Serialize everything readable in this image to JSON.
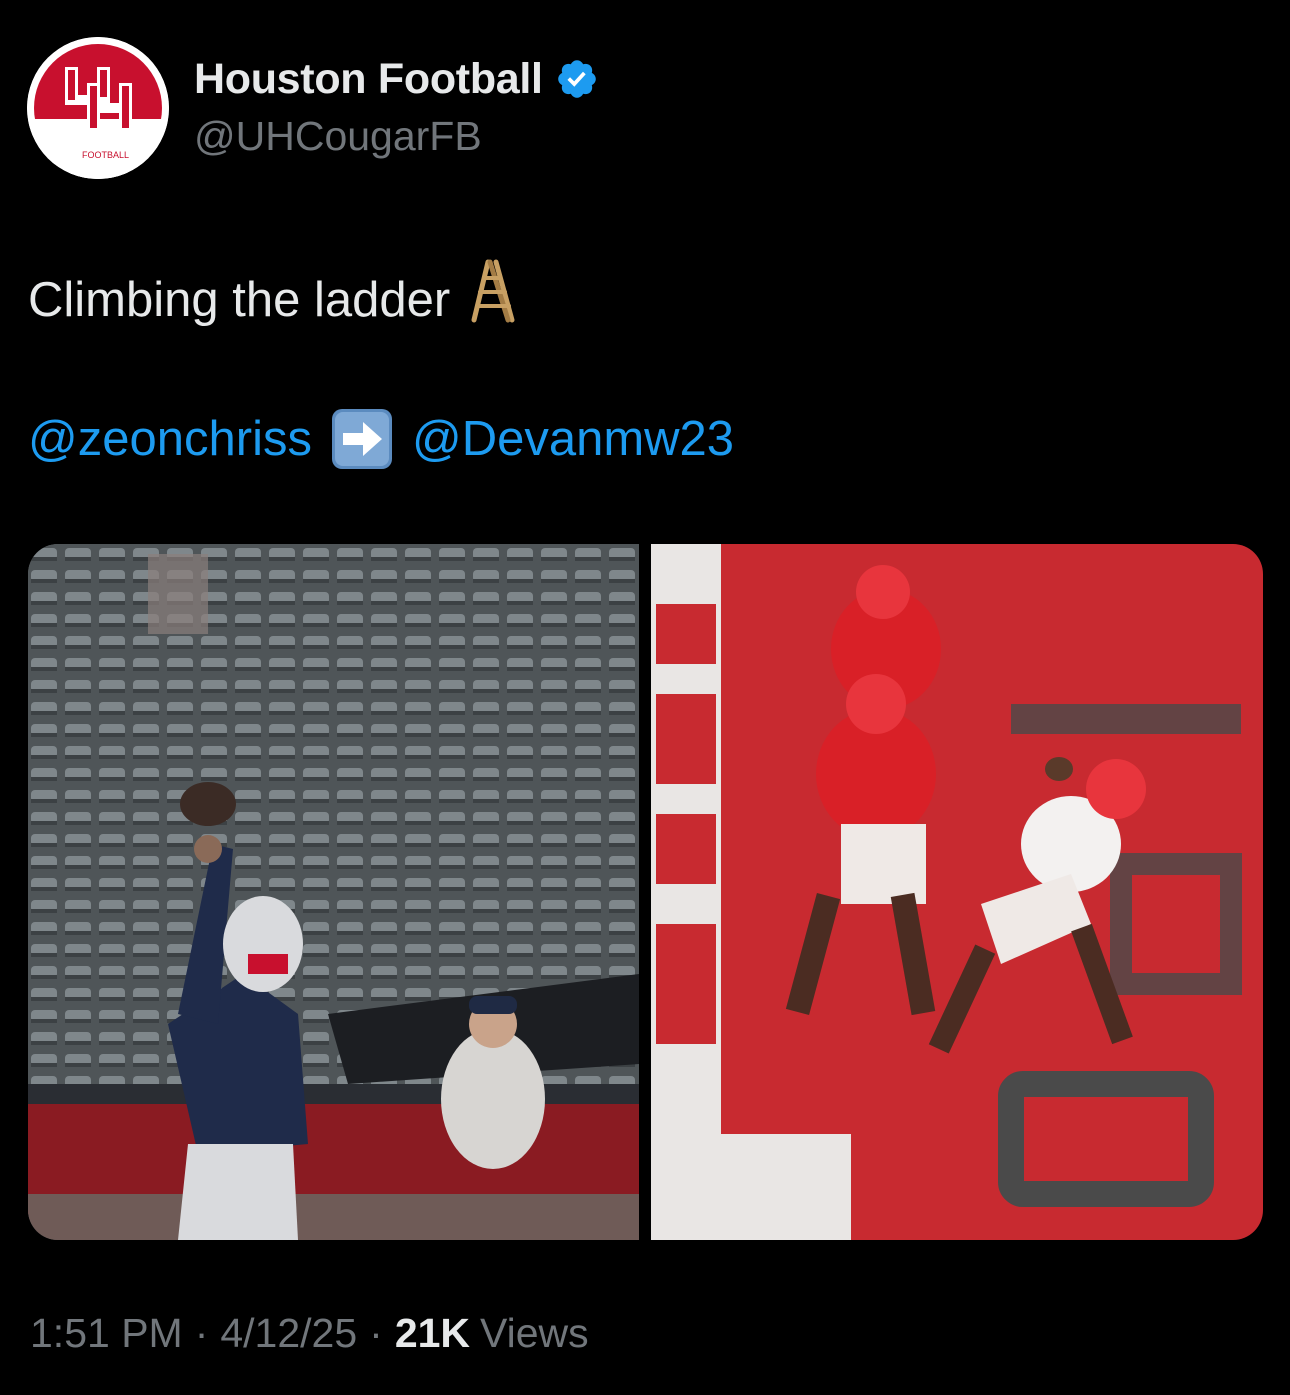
{
  "author": {
    "display_name": "Houston Football",
    "handle": "@UHCougarFB",
    "verified": true,
    "avatar_icon": "uh-football-logo",
    "avatar_logo_text": "FOOTBALL"
  },
  "tweet": {
    "text": "Climbing the ladder",
    "text_emoji": "ladder-emoji",
    "mention_1": "@zeonchriss",
    "arrow_emoji": "right-arrow-emoji",
    "mention_2": "@Devanmw23"
  },
  "media": {
    "count": 2,
    "photos": [
      {
        "description_icon": "quarterback-throwing-photo"
      },
      {
        "description_icon": "receiver-catching-endzone-photo"
      }
    ]
  },
  "meta": {
    "time": "1:51 PM",
    "separator": "·",
    "date": "4/12/25",
    "views_count": "21K",
    "views_label": "Views"
  },
  "colors": {
    "background": "#000000",
    "link": "#1d9bf0",
    "secondary_text": "#71767b",
    "primary_text": "#e7e9ea",
    "brand_red": "#c8102e"
  }
}
